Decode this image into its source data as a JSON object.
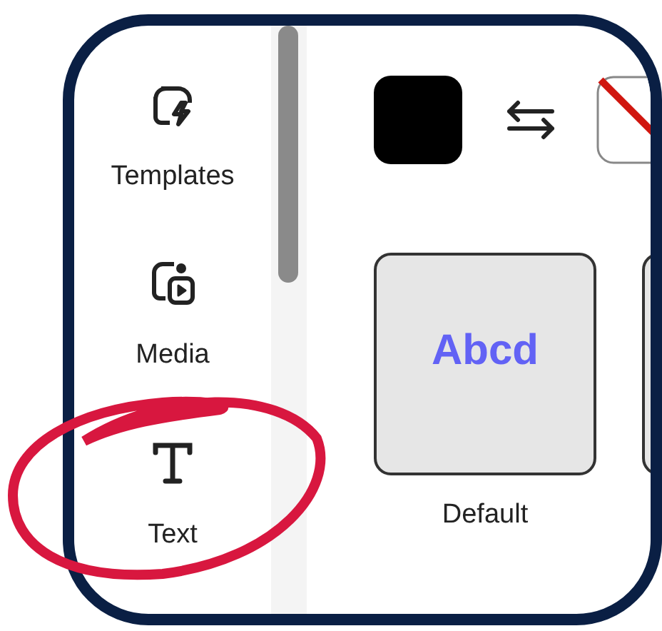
{
  "sidebar": {
    "items": [
      {
        "kind": "templates",
        "label": "Templates"
      },
      {
        "kind": "media",
        "label": "Media"
      },
      {
        "kind": "text",
        "label": "Text"
      }
    ]
  },
  "styles": [
    {
      "preview": "Abcd",
      "label": "Default"
    }
  ]
}
